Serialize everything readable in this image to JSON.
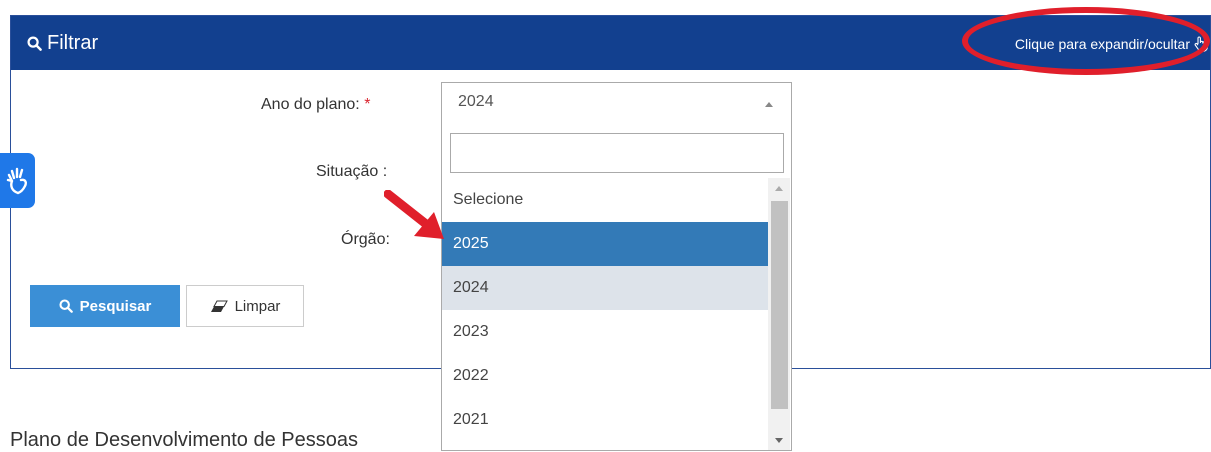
{
  "filter_panel": {
    "title": "Filtrar",
    "expand_link": "Clique para expandir/ocultar",
    "header_color": "#12408f"
  },
  "form": {
    "ano_label": "Ano do plano:",
    "required_mark": "*",
    "ano_value": "2024",
    "situacao_label": "Situação :",
    "orgao_label": "Órgão:"
  },
  "dropdown": {
    "search_value": "",
    "options": [
      "Selecione",
      "2025",
      "2024",
      "2023",
      "2022",
      "2021"
    ],
    "highlighted": "2025",
    "selected": "2024",
    "highlight_color": "#337ab7"
  },
  "buttons": {
    "search_label": "Pesquisar",
    "clear_label": "Limpar",
    "search_color": "#3b8fd6"
  },
  "page": {
    "section_title": "Plano de Desenvolvimento de Pessoas"
  },
  "icons": {
    "search": "search-icon",
    "eraser": "eraser-icon",
    "hand_pointer": "hand-pointer-icon",
    "accessibility": "hand-sign-icon"
  }
}
